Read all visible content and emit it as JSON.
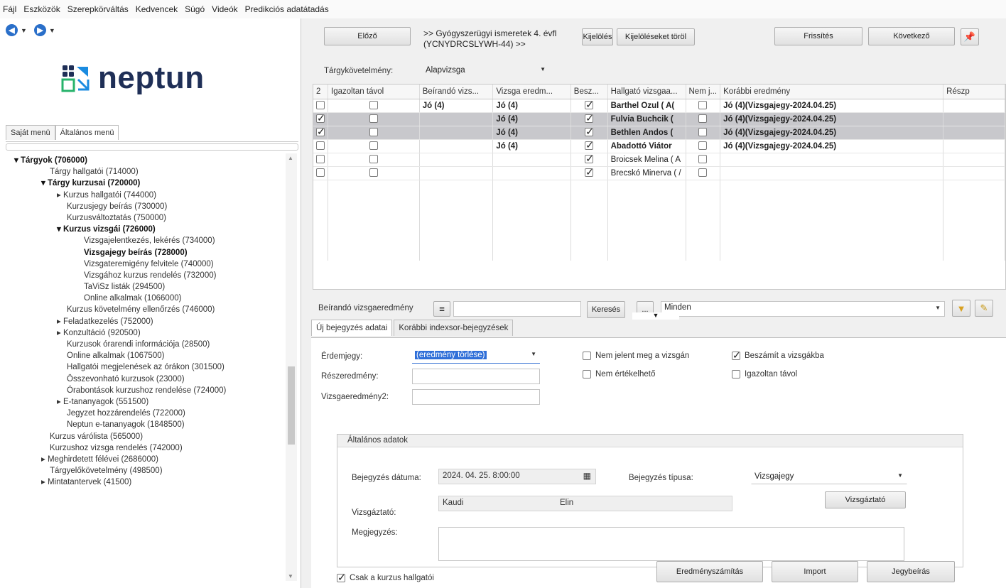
{
  "menubar": [
    "Fájl",
    "Eszközök",
    "Szerepkörváltás",
    "Kedvencek",
    "Súgó",
    "Videók",
    "Predikciós adatátadás"
  ],
  "logo": {
    "text": "neptun"
  },
  "menu_tabs": [
    "Saját menü",
    "Általános menü"
  ],
  "tree": [
    {
      "label": "▾  Tárgyok (706000)",
      "bold": true,
      "indent": 20
    },
    {
      "label": "Tárgy hallgatói (714000)",
      "bold": false,
      "indent": 70
    },
    {
      "label": "▾  Tárgy kurzusai (720000)",
      "bold": true,
      "indent": 58
    },
    {
      "label": "▸  Kurzus hallgatói (744000)",
      "bold": false,
      "indent": 80
    },
    {
      "label": "Kurzusjegy beírás (730000)",
      "bold": false,
      "indent": 94
    },
    {
      "label": "Kurzusváltoztatás (750000)",
      "bold": false,
      "indent": 94
    },
    {
      "label": "▾  Kurzus vizsgái (726000)",
      "bold": true,
      "indent": 80
    },
    {
      "label": "Vizsgajelentkezés, lekérés (734000)",
      "bold": false,
      "indent": 118
    },
    {
      "label": "Vizsgajegy beírás (728000)",
      "bold": true,
      "indent": 118
    },
    {
      "label": "Vizsgateremigény felvitele (740000)",
      "bold": false,
      "indent": 118
    },
    {
      "label": "Vizsgához kurzus rendelés (732000)",
      "bold": false,
      "indent": 118
    },
    {
      "label": "TaViSz listák (294500)",
      "bold": false,
      "indent": 118
    },
    {
      "label": "Online alkalmak (1066000)",
      "bold": false,
      "indent": 118
    },
    {
      "label": "Kurzus követelmény ellenőrzés (746000)",
      "bold": false,
      "indent": 94
    },
    {
      "label": "▸  Feladatkezelés (752000)",
      "bold": false,
      "indent": 80
    },
    {
      "label": "▸  Konzultáció (920500)",
      "bold": false,
      "indent": 80
    },
    {
      "label": "Kurzusok órarendi információja (28500)",
      "bold": false,
      "indent": 94
    },
    {
      "label": "Online alkalmak (1067500)",
      "bold": false,
      "indent": 94
    },
    {
      "label": "Hallgatói megjelenések az órákon (301500)",
      "bold": false,
      "indent": 94
    },
    {
      "label": "Összevonható kurzusok (23000)",
      "bold": false,
      "indent": 94
    },
    {
      "label": "Órabontások kurzushoz rendelése (724000)",
      "bold": false,
      "indent": 94
    },
    {
      "label": "▸  E-tananyagok (551500)",
      "bold": false,
      "indent": 80
    },
    {
      "label": "Jegyzet hozzárendelés (722000)",
      "bold": false,
      "indent": 94
    },
    {
      "label": "Neptun e-tananyagok (1848500)",
      "bold": false,
      "indent": 94
    },
    {
      "label": "Kurzus várólista (565000)",
      "bold": false,
      "indent": 70
    },
    {
      "label": "Kurzushoz vizsga rendelés (742000)",
      "bold": false,
      "indent": 70
    },
    {
      "label": "▸  Meghirdetett félévei (2686000)",
      "bold": false,
      "indent": 58
    },
    {
      "label": "Tárgyelőkövetelmény (498500)",
      "bold": false,
      "indent": 70
    },
    {
      "label": "▸  Mintatantervek (41500)",
      "bold": false,
      "indent": 58
    }
  ],
  "toolbar": {
    "prev": "Előző",
    "record_title": ">> Gyógyszerügyi ismeretek 4. évfl (YCNYDRCSLYWH-44) >>",
    "mark": "Kijelölés",
    "unmark": "Kijelöléseket töröl",
    "refresh": "Frissítés",
    "next": "Következő"
  },
  "requirement": {
    "label": "Tárgykövetelmény:",
    "value": "Alapvizsga"
  },
  "table": {
    "count": "2",
    "headers": [
      "Igazoltan távol",
      "Beírandó vizs...",
      "Vizsga eredm...",
      "Besz...",
      "Hallgató vizsgaa...",
      "Nem j...",
      "Korábbi eredmény",
      "Részp"
    ],
    "rows": [
      {
        "sel": false,
        "selected_row": false,
        "igazolt": false,
        "beirando": "Jó (4)",
        "eredmeny": "Jó (4)",
        "besz": true,
        "hallgato": "Barthel Ozul ( A(",
        "nemj": false,
        "korabbi": "Jó (4)(Vizsgajegy-2024.04.25)",
        "bold": true
      },
      {
        "sel": true,
        "selected_row": true,
        "igazolt": false,
        "beirando": "",
        "eredmeny": "Jó (4)",
        "besz": true,
        "hallgato": "Fulvia Buchcik (",
        "nemj": false,
        "korabbi": "Jó (4)(Vizsgajegy-2024.04.25)",
        "bold": true
      },
      {
        "sel": true,
        "selected_row": true,
        "igazolt": false,
        "beirando": "",
        "eredmeny": "Jó (4)",
        "besz": true,
        "hallgato": "Bethlen Andos (",
        "nemj": false,
        "korabbi": "Jó (4)(Vizsgajegy-2024.04.25)",
        "bold": true
      },
      {
        "sel": false,
        "selected_row": false,
        "igazolt": false,
        "beirando": "",
        "eredmeny": "Jó (4)",
        "besz": true,
        "hallgato": "Abadottó Viátor",
        "nemj": false,
        "korabbi": "Jó (4)(Vizsgajegy-2024.04.25)",
        "bold": true
      },
      {
        "sel": false,
        "selected_row": false,
        "igazolt": false,
        "beirando": "",
        "eredmeny": "",
        "besz": true,
        "hallgato": "Broicsek Melina ( A",
        "nemj": false,
        "korabbi": "",
        "bold": false
      },
      {
        "sel": false,
        "selected_row": false,
        "igazolt": false,
        "beirando": "",
        "eredmeny": "",
        "besz": true,
        "hallgato": "Brecskó Minerva ( /",
        "nemj": false,
        "korabbi": "",
        "bold": false
      }
    ]
  },
  "filter": {
    "field_label": "Beírandó vizsgaeredmény",
    "operator": "=",
    "value": "",
    "search": "Keresés",
    "more": "...",
    "scope": "Minden"
  },
  "tabs": [
    "Új bejegyzés adatai",
    "Korábbi indexsor-bejegyzések"
  ],
  "entry": {
    "grade_label": "Érdemjegy:",
    "grade_value": "(eredmény törlése)",
    "partial_label": "Részeredmény:",
    "exam2_label": "Vizsgaeredmény2:",
    "no_show": "Nem jelent meg a vizsgán",
    "not_assessable": "Nem értékelhető",
    "counts": "Beszámít a vizsgákba",
    "excused": "Igazoltan távol"
  },
  "general": {
    "title": "Általános adatok",
    "date_label": "Bejegyzés dátuma:",
    "date_value": "2024. 04. 25. 8:00:00",
    "type_label": "Bejegyzés típusa:",
    "type_value": "Vizsgajegy",
    "examiner_label": "Vizsgáztató:",
    "examiner_last": "Kaudi",
    "examiner_first": "Elin",
    "examiner_button": "Vizsgáztató",
    "comment_label": "Megjegyzés:"
  },
  "footer": {
    "only_students": "Csak a kurzus hallgatói",
    "calc": "Eredményszámítás",
    "import": "Import",
    "write": "Jegybeírás"
  }
}
